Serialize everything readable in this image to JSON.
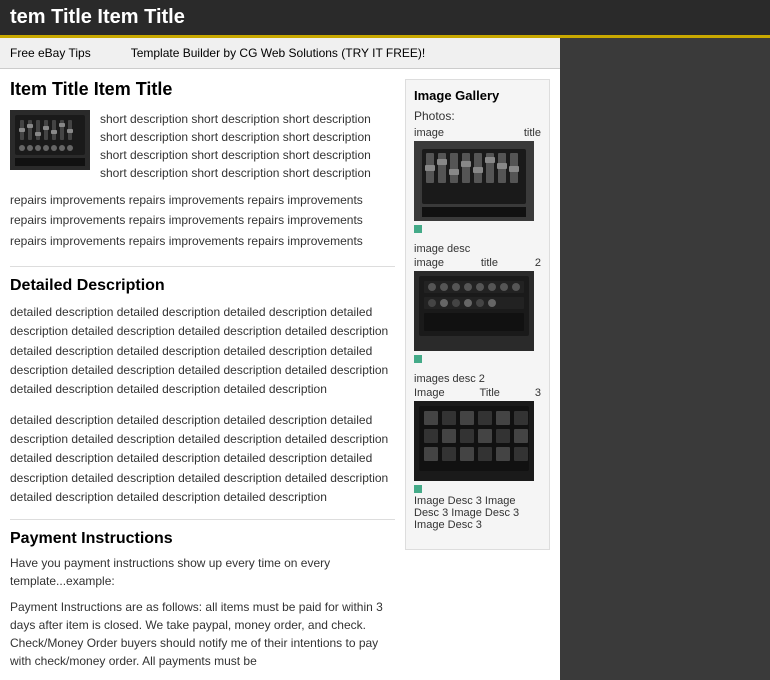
{
  "topBar": {
    "title": "tem Title Item Title"
  },
  "header": {
    "leftText": "Free eBay Tips",
    "rightText": "Template Builder by CG Web Solutions (TRY IT FREE)!"
  },
  "item": {
    "title": "Item Title Item Title",
    "shortDesc": "short description short description short description short description short description short description short description short description short description short description short description short description",
    "repairsText": "repairs  improvements  repairs  improvements  repairs improvements  repairs  improvements  repairs  improvements repairs  improvements  repairs  improvements  repairs improvements repairs improvements"
  },
  "detailedDesc": {
    "title": "Detailed Description",
    "para1": "detailed description detailed description detailed description detailed description detailed description detailed description detailed description detailed description detailed description detailed description detailed description detailed description detailed description detailed description detailed description detailed description detailed description",
    "para2": "detailed description detailed description detailed description detailed description detailed description detailed description detailed description detailed description detailed description detailed description detailed description detailed description detailed description detailed description detailed description detailed description detailed description"
  },
  "payment": {
    "title": "Payment Instructions",
    "intro": "Have you payment instructions show up every time on every template...example:",
    "details": "Payment Instructions are as follows: all items must be paid for within 3 days after item is closed. We take paypal, money order, and check. Check/Money Order buyers should notify me of their intentions to pay with check/money order. All payments must be"
  },
  "gallery": {
    "title": "Image Gallery",
    "photosLabel": "Photos:",
    "items": [
      {
        "imageLabel": "image",
        "titleLabel": "title",
        "desc": "",
        "number": ""
      },
      {
        "imageLabel": "image",
        "titleLabel": "title",
        "desc": "image desc",
        "number": "2"
      },
      {
        "imageLabel": "Image",
        "titleLabel": "Title",
        "desc": "images desc 2",
        "number": "3"
      }
    ],
    "lastDesc": "Image Desc 3 Image Desc 3 Image Desc 3 Image Desc 3"
  }
}
